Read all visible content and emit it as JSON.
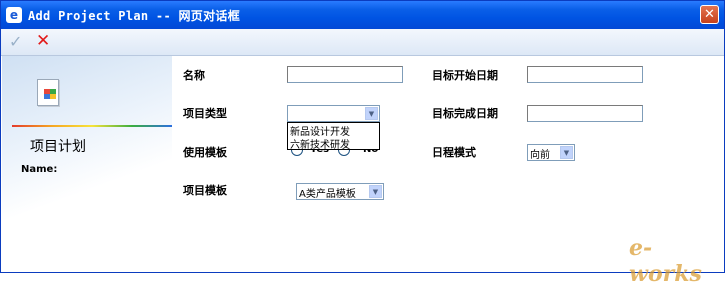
{
  "window": {
    "title": "Add Project Plan -- 网页对话框",
    "icon": "ie-icon",
    "close_glyph": "✕"
  },
  "toolbar": {
    "confirm_glyph": "✓",
    "cancel_glyph": "✕"
  },
  "left_panel": {
    "heading": "项目计划",
    "name_label": "Name:"
  },
  "form": {
    "name_label": "名称",
    "name_value": "",
    "start_date_label": "目标开始日期",
    "start_date_value": "",
    "project_type_label": "项目类型",
    "project_type_value": "",
    "project_type_options": [
      "新品设计开发",
      "六新技术研发"
    ],
    "end_date_label": "目标完成日期",
    "end_date_value": "",
    "use_template_label": "使用模板",
    "use_template_yes": "Yes",
    "use_template_no": "No",
    "schedule_mode_label": "日程模式",
    "schedule_mode_value": "向前",
    "template_label": "项目模板",
    "template_value": "A类产品模板"
  },
  "watermark": "e-works"
}
